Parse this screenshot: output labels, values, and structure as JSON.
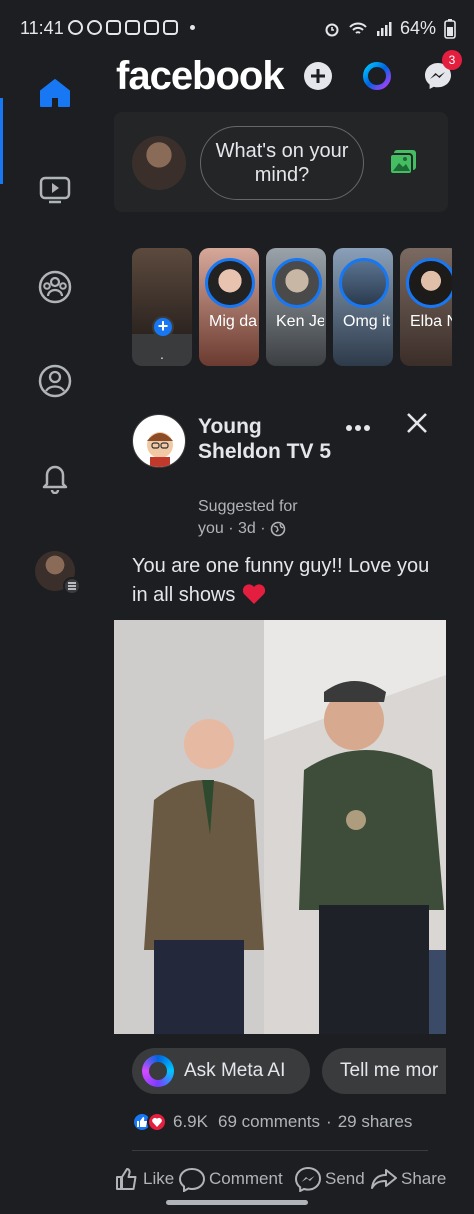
{
  "status_bar": {
    "time": "11:41",
    "battery": "64%"
  },
  "left_nav": [
    {
      "name": "home-icon",
      "active": true
    },
    {
      "name": "video-icon",
      "active": false
    },
    {
      "name": "groups-icon",
      "active": false
    },
    {
      "name": "profile-icon",
      "active": false
    },
    {
      "name": "bell-icon",
      "active": false
    },
    {
      "name": "menu-avatar",
      "active": false
    }
  ],
  "header": {
    "logo": "facebook",
    "messenger_badge": "3"
  },
  "composer": {
    "prompt": "What's on your mind?"
  },
  "stories": [
    {
      "label": "."
    },
    {
      "label": "Mig dal..."
    },
    {
      "label": "Ken Je..."
    },
    {
      "label": "Omg its..."
    },
    {
      "label": "Elba N"
    }
  ],
  "post": {
    "page_name": "Young Sheldon TV 5",
    "meta_line1": "Suggested for",
    "meta_line2": "you · 3d ·",
    "text": "You are one funny guy!! Love you in all shows",
    "chips": [
      "Ask Meta AI",
      "Tell me mor"
    ],
    "reaction_count": "6.9K",
    "comments": "69 comments",
    "separator": "·",
    "shares": "29 shares",
    "actions": [
      "Like",
      "Comment",
      "Send",
      "Share"
    ]
  },
  "colors": {
    "background": "#1c1e21",
    "card": "#242526",
    "accent": "#1877f2",
    "badge": "#e41e3f",
    "text": "#e4e6eb",
    "muted": "#b0b3b8"
  }
}
